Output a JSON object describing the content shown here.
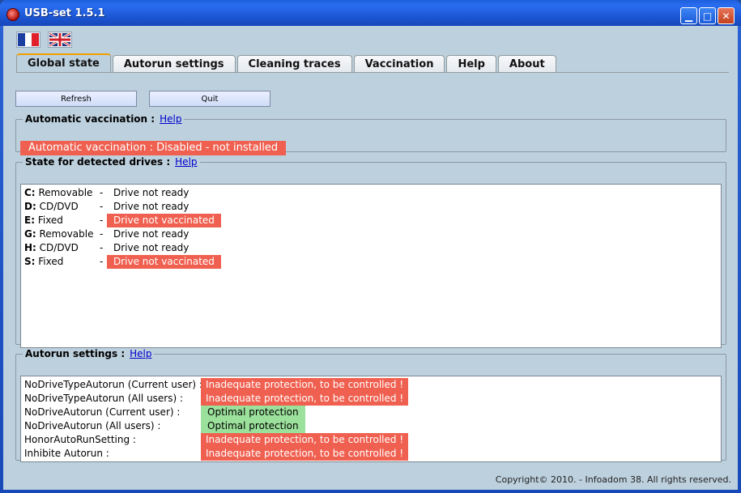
{
  "window": {
    "title": "USB-set 1.5.1"
  },
  "titlebar_buttons": {
    "minimize": "▁",
    "maximize": "□",
    "close": "✕"
  },
  "flags": [
    "French flag",
    "UK flag"
  ],
  "tabs": [
    {
      "label": "Global state",
      "active": true
    },
    {
      "label": "Autorun settings",
      "active": false
    },
    {
      "label": "Cleaning traces",
      "active": false
    },
    {
      "label": "Vaccination",
      "active": false
    },
    {
      "label": "Help",
      "active": false
    },
    {
      "label": "About",
      "active": false
    }
  ],
  "buttons": {
    "refresh": "Refresh",
    "quit": "Quit"
  },
  "auto_vaccination": {
    "legend": "Automatic vaccination :",
    "help": "Help",
    "status": "Automatic vaccination : Disabled - not installed"
  },
  "drives": {
    "legend": "State for detected drives :",
    "help": "Help",
    "items": [
      {
        "letter": "C:",
        "type": "Removable",
        "sep": "-",
        "state": "Drive not ready",
        "alert": false
      },
      {
        "letter": "D:",
        "type": "CD/DVD",
        "sep": "-",
        "state": "Drive not ready",
        "alert": false
      },
      {
        "letter": "E:",
        "type": "Fixed",
        "sep": "-",
        "state": "Drive not vaccinated",
        "alert": true
      },
      {
        "letter": "G:",
        "type": "Removable",
        "sep": "-",
        "state": "Drive not ready",
        "alert": false
      },
      {
        "letter": "H:",
        "type": "CD/DVD",
        "sep": "-",
        "state": "Drive not ready",
        "alert": false
      },
      {
        "letter": "S:",
        "type": "Fixed",
        "sep": "-",
        "state": "Drive not vaccinated",
        "alert": true
      }
    ]
  },
  "autorun": {
    "legend": "Autorun settings :",
    "help": "Help",
    "items": [
      {
        "name": "NoDriveTypeAutorun (Current user) :",
        "status": "Inadequate protection, to be controlled !",
        "ok": false
      },
      {
        "name": "NoDriveTypeAutorun (All users) :",
        "status": "Inadequate protection, to be controlled !",
        "ok": false
      },
      {
        "name": "NoDriveAutorun (Current user) :",
        "status": "Optimal protection",
        "ok": true
      },
      {
        "name": "NoDriveAutorun (All users) :",
        "status": "Optimal protection",
        "ok": true
      },
      {
        "name": "HonorAutoRunSetting :",
        "status": "Inadequate protection, to be controlled !",
        "ok": false
      },
      {
        "name": "Inhibite Autorun :",
        "status": "Inadequate protection, to be controlled !",
        "ok": false
      }
    ]
  },
  "copyright": "Copyright© 2010. - Infoadom 38. All rights reserved."
}
